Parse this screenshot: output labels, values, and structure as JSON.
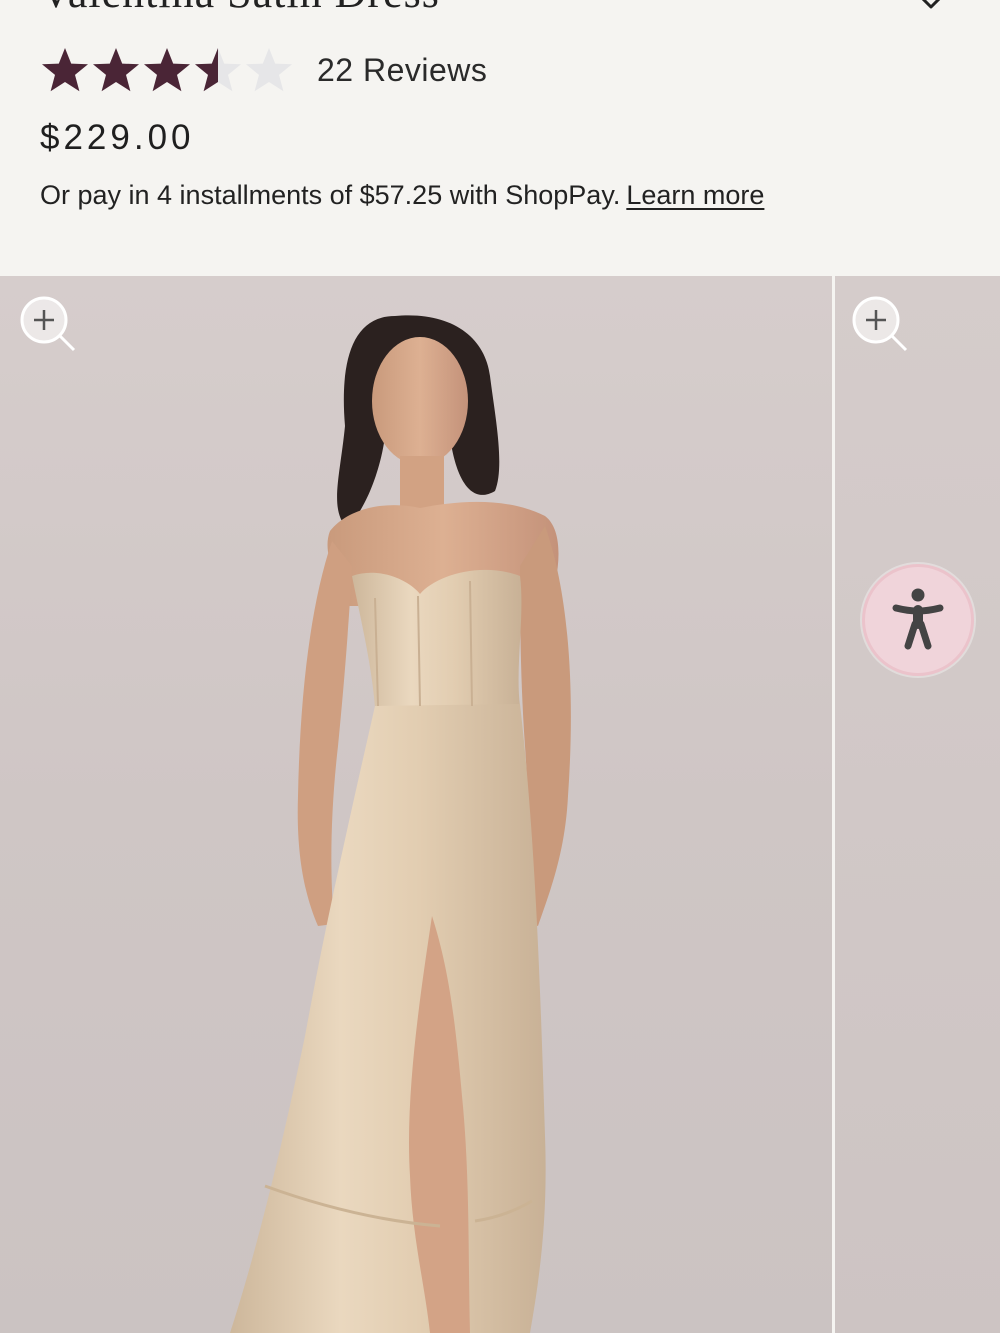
{
  "product": {
    "title": "Valentina Satin Dress",
    "rating": 3.5,
    "rating_max": 5,
    "reviews_label": "22 Reviews",
    "price": "$229.00",
    "installments_text": "Or pay in 4 installments of $57.25 with ShopPay.",
    "learn_more": "Learn more"
  },
  "colors": {
    "star_filled": "#4a2536",
    "star_empty": "#e6e6e8",
    "page_bg": "#f5f4f1",
    "photo_bg": "#d3cac9",
    "dress": "#e3cfb4",
    "a11y_bg": "#f0d4da"
  },
  "icons": {
    "wishlist": "heart-outline-icon",
    "zoom": "zoom-in-icon",
    "accessibility": "accessibility-person-icon",
    "star": "star-icon"
  }
}
